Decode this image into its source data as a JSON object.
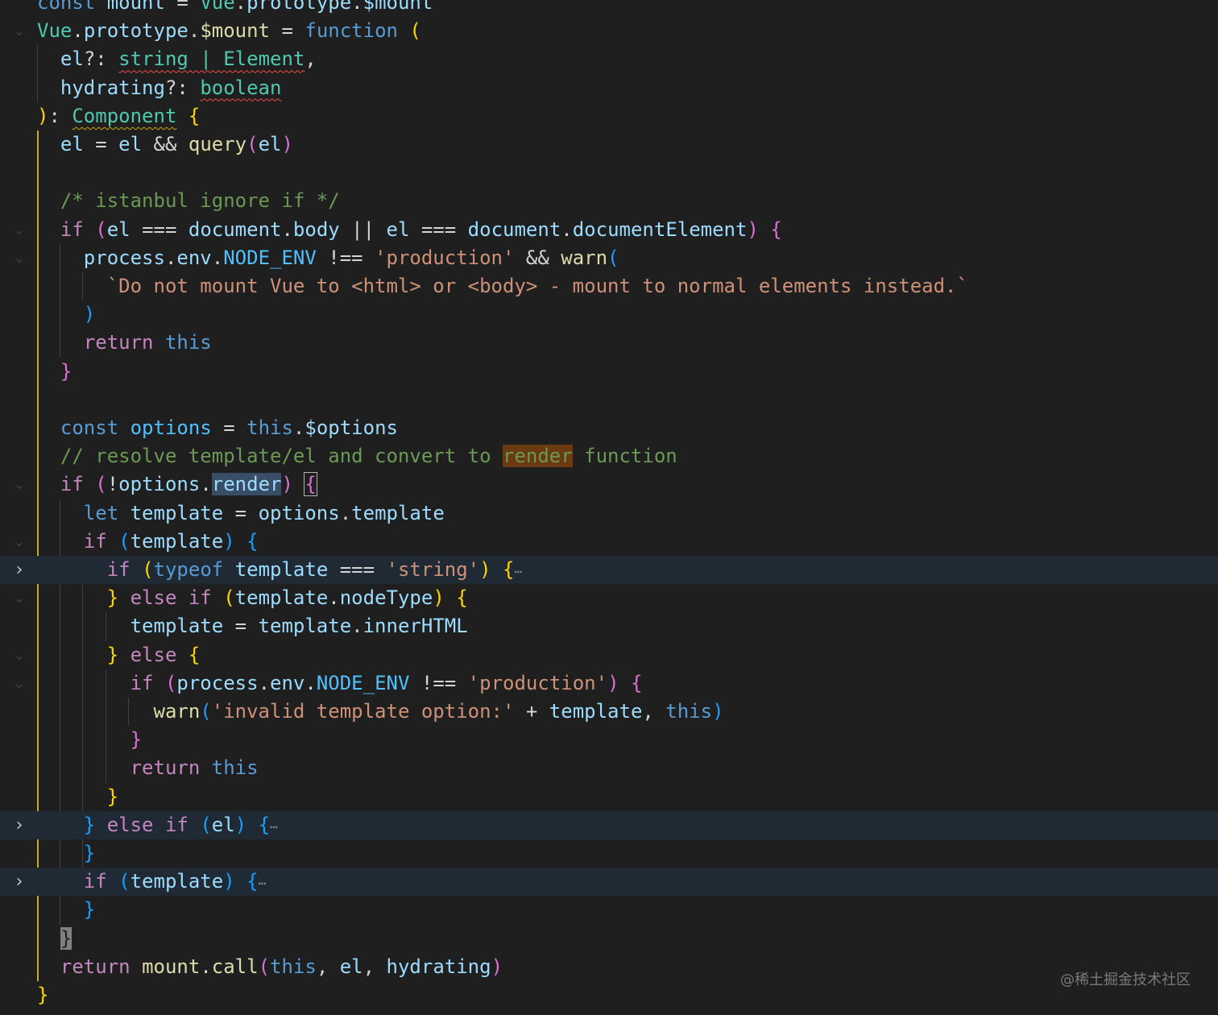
{
  "editor": {
    "theme": "dark",
    "colors": {
      "background": "#1f1f1f",
      "keyword": "#569cd6",
      "control": "#c586c0",
      "function": "#dcdcaa",
      "variable": "#9cdcfe",
      "type": "#4ec9b0",
      "string": "#ce9178",
      "comment": "#6a9955",
      "active_indent_guide": "#c8a838"
    },
    "lines": [
      {
        "gutter": "none",
        "folded": false,
        "tokens": [
          [
            "kw",
            "const"
          ],
          [
            "pn",
            " "
          ],
          [
            "var",
            "mount"
          ],
          [
            "pn",
            " = "
          ],
          [
            "ty",
            "Vue"
          ],
          [
            "pn",
            "."
          ],
          [
            "var",
            "prototype"
          ],
          [
            "pn",
            "."
          ],
          [
            "var",
            "$mount"
          ]
        ]
      },
      {
        "gutter": "open",
        "folded": false,
        "tokens": [
          [
            "ty",
            "Vue"
          ],
          [
            "pn",
            "."
          ],
          [
            "var",
            "prototype"
          ],
          [
            "pn",
            "."
          ],
          [
            "fn",
            "$mount"
          ],
          [
            "pn",
            " = "
          ],
          [
            "kw",
            "function"
          ],
          [
            "pn",
            " "
          ],
          [
            "b1",
            "("
          ]
        ]
      },
      {
        "gutter": "none",
        "folded": false,
        "tokens": [
          [
            "pn",
            "  "
          ],
          [
            "var",
            "el"
          ],
          [
            "pn",
            "?: "
          ],
          [
            "ty squig",
            "string | Element"
          ],
          [
            "pn",
            ","
          ]
        ]
      },
      {
        "gutter": "none",
        "folded": false,
        "tokens": [
          [
            "pn",
            "  "
          ],
          [
            "var",
            "hydrating"
          ],
          [
            "pn",
            "?: "
          ],
          [
            "ty squig",
            "boolean"
          ]
        ]
      },
      {
        "gutter": "none",
        "folded": false,
        "tokens": [
          [
            "b1",
            ")"
          ],
          [
            "pn",
            ": "
          ],
          [
            "ty squig-warn",
            "Component"
          ],
          [
            "pn",
            " "
          ],
          [
            "b1",
            "{"
          ]
        ]
      },
      {
        "gutter": "none",
        "folded": false,
        "tokens": [
          [
            "pn",
            "  "
          ],
          [
            "var",
            "el"
          ],
          [
            "pn",
            " = "
          ],
          [
            "var",
            "el"
          ],
          [
            "pn",
            " && "
          ],
          [
            "fn",
            "query"
          ],
          [
            "b2",
            "("
          ],
          [
            "var",
            "el"
          ],
          [
            "b2",
            ")"
          ]
        ]
      },
      {
        "gutter": "none",
        "folded": false,
        "tokens": []
      },
      {
        "gutter": "none",
        "folded": false,
        "tokens": [
          [
            "pn",
            "  "
          ],
          [
            "com",
            "/* istanbul ignore if */"
          ]
        ]
      },
      {
        "gutter": "open",
        "folded": false,
        "tokens": [
          [
            "pn",
            "  "
          ],
          [
            "ctl",
            "if"
          ],
          [
            "pn",
            " "
          ],
          [
            "b2",
            "("
          ],
          [
            "var",
            "el"
          ],
          [
            "pn",
            " === "
          ],
          [
            "var",
            "document"
          ],
          [
            "pn",
            "."
          ],
          [
            "var",
            "body"
          ],
          [
            "pn",
            " || "
          ],
          [
            "var",
            "el"
          ],
          [
            "pn",
            " === "
          ],
          [
            "var",
            "document"
          ],
          [
            "pn",
            "."
          ],
          [
            "var",
            "documentElement"
          ],
          [
            "b2",
            ")"
          ],
          [
            "pn",
            " "
          ],
          [
            "b2",
            "{"
          ]
        ]
      },
      {
        "gutter": "open",
        "folded": false,
        "tokens": [
          [
            "pn",
            "    "
          ],
          [
            "var",
            "process"
          ],
          [
            "pn",
            "."
          ],
          [
            "var",
            "env"
          ],
          [
            "pn",
            "."
          ],
          [
            "cst",
            "NODE_ENV"
          ],
          [
            "pn",
            " !== "
          ],
          [
            "str",
            "'production'"
          ],
          [
            "pn",
            " && "
          ],
          [
            "fn",
            "warn"
          ],
          [
            "b3",
            "("
          ]
        ]
      },
      {
        "gutter": "none",
        "folded": false,
        "tokens": [
          [
            "pn",
            "      "
          ],
          [
            "str",
            "`Do not mount Vue to <html> or <body> - mount to normal elements instead.`"
          ]
        ]
      },
      {
        "gutter": "none",
        "folded": false,
        "tokens": [
          [
            "pn",
            "    "
          ],
          [
            "b3",
            ")"
          ]
        ]
      },
      {
        "gutter": "none",
        "folded": false,
        "tokens": [
          [
            "pn",
            "    "
          ],
          [
            "ctl",
            "return"
          ],
          [
            "pn",
            " "
          ],
          [
            "kw",
            "this"
          ]
        ]
      },
      {
        "gutter": "none",
        "folded": false,
        "tokens": [
          [
            "pn",
            "  "
          ],
          [
            "b2",
            "}"
          ]
        ]
      },
      {
        "gutter": "none",
        "folded": false,
        "tokens": []
      },
      {
        "gutter": "none",
        "folded": false,
        "tokens": [
          [
            "pn",
            "  "
          ],
          [
            "kw",
            "const"
          ],
          [
            "pn",
            " "
          ],
          [
            "cst",
            "options"
          ],
          [
            "pn",
            " = "
          ],
          [
            "kw",
            "this"
          ],
          [
            "pn",
            "."
          ],
          [
            "var",
            "$options"
          ]
        ]
      },
      {
        "gutter": "none",
        "folded": false,
        "tokens": [
          [
            "pn",
            "  "
          ],
          [
            "com",
            "// resolve template/el and convert to "
          ],
          [
            "com hl-find",
            "render"
          ],
          [
            "com",
            " function"
          ]
        ]
      },
      {
        "gutter": "open",
        "folded": false,
        "tokens": [
          [
            "pn",
            "  "
          ],
          [
            "ctl",
            "if"
          ],
          [
            "pn",
            " "
          ],
          [
            "b2",
            "("
          ],
          [
            "pn",
            "!"
          ],
          [
            "var",
            "options"
          ],
          [
            "pn",
            "."
          ],
          [
            "var hl-sel",
            "render"
          ],
          [
            "b2",
            ")"
          ],
          [
            "pn",
            " "
          ],
          [
            "b2 hl-bracket",
            "{"
          ]
        ]
      },
      {
        "gutter": "none",
        "folded": false,
        "tokens": [
          [
            "pn",
            "    "
          ],
          [
            "kw",
            "let"
          ],
          [
            "pn",
            " "
          ],
          [
            "var",
            "template"
          ],
          [
            "pn",
            " = "
          ],
          [
            "var",
            "options"
          ],
          [
            "pn",
            "."
          ],
          [
            "var",
            "template"
          ]
        ]
      },
      {
        "gutter": "open",
        "folded": false,
        "tokens": [
          [
            "pn",
            "    "
          ],
          [
            "ctl",
            "if"
          ],
          [
            "pn",
            " "
          ],
          [
            "b3",
            "("
          ],
          [
            "var",
            "template"
          ],
          [
            "b3",
            ")"
          ],
          [
            "pn",
            " "
          ],
          [
            "b3",
            "{"
          ]
        ]
      },
      {
        "gutter": "closed",
        "folded": true,
        "tokens": [
          [
            "pn",
            "      "
          ],
          [
            "ctl",
            "if"
          ],
          [
            "pn",
            " "
          ],
          [
            "b1",
            "("
          ],
          [
            "kw",
            "typeof"
          ],
          [
            "pn",
            " "
          ],
          [
            "var",
            "template"
          ],
          [
            "pn",
            " === "
          ],
          [
            "str",
            "'string'"
          ],
          [
            "b1",
            ")"
          ],
          [
            "pn",
            " "
          ],
          [
            "b1",
            "{"
          ],
          [
            "ellipsis",
            "⋯"
          ]
        ]
      },
      {
        "gutter": "open",
        "folded": false,
        "tokens": [
          [
            "pn",
            "      "
          ],
          [
            "b1",
            "}"
          ],
          [
            "pn",
            " "
          ],
          [
            "ctl",
            "else if"
          ],
          [
            "pn",
            " "
          ],
          [
            "b1",
            "("
          ],
          [
            "var",
            "template"
          ],
          [
            "pn",
            "."
          ],
          [
            "var",
            "nodeType"
          ],
          [
            "b1",
            ")"
          ],
          [
            "pn",
            " "
          ],
          [
            "b1",
            "{"
          ]
        ]
      },
      {
        "gutter": "none",
        "folded": false,
        "tokens": [
          [
            "pn",
            "        "
          ],
          [
            "var",
            "template"
          ],
          [
            "pn",
            " = "
          ],
          [
            "var",
            "template"
          ],
          [
            "pn",
            "."
          ],
          [
            "var",
            "innerHTML"
          ]
        ]
      },
      {
        "gutter": "open",
        "folded": false,
        "tokens": [
          [
            "pn",
            "      "
          ],
          [
            "b1",
            "}"
          ],
          [
            "pn",
            " "
          ],
          [
            "ctl",
            "else"
          ],
          [
            "pn",
            " "
          ],
          [
            "b1",
            "{"
          ]
        ]
      },
      {
        "gutter": "open",
        "folded": false,
        "tokens": [
          [
            "pn",
            "        "
          ],
          [
            "ctl",
            "if"
          ],
          [
            "pn",
            " "
          ],
          [
            "b2",
            "("
          ],
          [
            "var",
            "process"
          ],
          [
            "pn",
            "."
          ],
          [
            "var",
            "env"
          ],
          [
            "pn",
            "."
          ],
          [
            "cst",
            "NODE_ENV"
          ],
          [
            "pn",
            " !== "
          ],
          [
            "str",
            "'production'"
          ],
          [
            "b2",
            ")"
          ],
          [
            "pn",
            " "
          ],
          [
            "b2",
            "{"
          ]
        ]
      },
      {
        "gutter": "none",
        "folded": false,
        "tokens": [
          [
            "pn",
            "          "
          ],
          [
            "fn",
            "warn"
          ],
          [
            "b3",
            "("
          ],
          [
            "str",
            "'invalid template option:'"
          ],
          [
            "pn",
            " + "
          ],
          [
            "var",
            "template"
          ],
          [
            "pn",
            ", "
          ],
          [
            "kw",
            "this"
          ],
          [
            "b3",
            ")"
          ]
        ]
      },
      {
        "gutter": "none",
        "folded": false,
        "tokens": [
          [
            "pn",
            "        "
          ],
          [
            "b2",
            "}"
          ]
        ]
      },
      {
        "gutter": "none",
        "folded": false,
        "tokens": [
          [
            "pn",
            "        "
          ],
          [
            "ctl",
            "return"
          ],
          [
            "pn",
            " "
          ],
          [
            "kw",
            "this"
          ]
        ]
      },
      {
        "gutter": "none",
        "folded": false,
        "tokens": [
          [
            "pn",
            "      "
          ],
          [
            "b1",
            "}"
          ]
        ]
      },
      {
        "gutter": "closed",
        "folded": true,
        "tokens": [
          [
            "pn",
            "    "
          ],
          [
            "b3",
            "}"
          ],
          [
            "pn",
            " "
          ],
          [
            "ctl",
            "else if"
          ],
          [
            "pn",
            " "
          ],
          [
            "b3",
            "("
          ],
          [
            "var",
            "el"
          ],
          [
            "b3",
            ")"
          ],
          [
            "pn",
            " "
          ],
          [
            "b3",
            "{"
          ],
          [
            "ellipsis",
            "⋯"
          ]
        ]
      },
      {
        "gutter": "none",
        "folded": false,
        "tokens": [
          [
            "pn",
            "    "
          ],
          [
            "b3",
            "}"
          ]
        ]
      },
      {
        "gutter": "closed",
        "folded": true,
        "tokens": [
          [
            "pn",
            "    "
          ],
          [
            "ctl",
            "if"
          ],
          [
            "pn",
            " "
          ],
          [
            "b3",
            "("
          ],
          [
            "var",
            "template"
          ],
          [
            "b3",
            ")"
          ],
          [
            "pn",
            " "
          ],
          [
            "b3",
            "{"
          ],
          [
            "ellipsis",
            "⋯"
          ]
        ]
      },
      {
        "gutter": "none",
        "folded": false,
        "tokens": [
          [
            "pn",
            "    "
          ],
          [
            "b3",
            "}"
          ]
        ]
      },
      {
        "gutter": "none",
        "folded": false,
        "tokens": [
          [
            "pn",
            "  "
          ],
          [
            "b2 cursor-box",
            "}"
          ]
        ]
      },
      {
        "gutter": "none",
        "folded": false,
        "tokens": [
          [
            "pn",
            "  "
          ],
          [
            "ctl",
            "return"
          ],
          [
            "pn",
            " "
          ],
          [
            "fn",
            "mount"
          ],
          [
            "pn",
            "."
          ],
          [
            "fn",
            "call"
          ],
          [
            "b2",
            "("
          ],
          [
            "kw",
            "this"
          ],
          [
            "pn",
            ", "
          ],
          [
            "var",
            "el"
          ],
          [
            "pn",
            ", "
          ],
          [
            "var",
            "hydrating"
          ],
          [
            "b2",
            ")"
          ]
        ]
      },
      {
        "gutter": "none",
        "folded": false,
        "tokens": [
          [
            "b1",
            "}"
          ]
        ]
      }
    ]
  },
  "watermark": "@稀土掘金技术社区"
}
